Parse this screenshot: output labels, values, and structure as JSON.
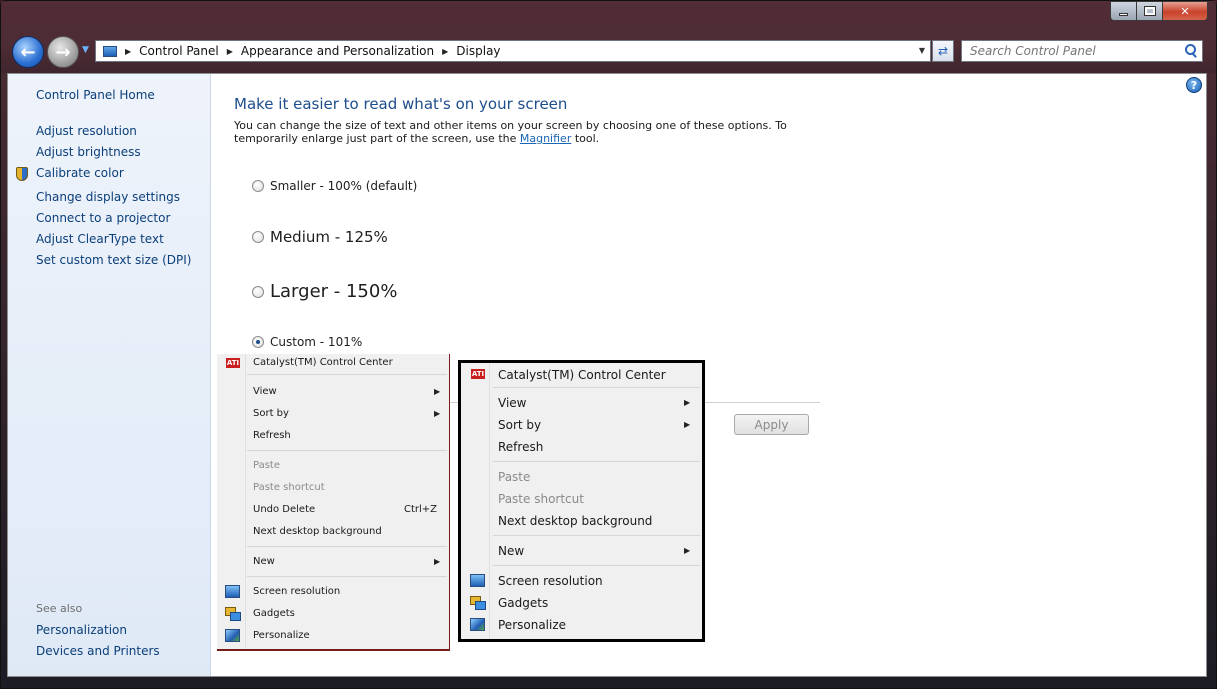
{
  "window": {
    "controls": {
      "minimize": "",
      "maximize": "",
      "close": "✕"
    }
  },
  "nav": {
    "back_icon": "back-arrow-icon",
    "forward_icon": "forward-arrow-icon",
    "breadcrumbs": [
      "Control Panel",
      "Appearance and Personalization",
      "Display"
    ],
    "search_placeholder": "Search Control Panel"
  },
  "sidebar": {
    "home": "Control Panel Home",
    "items": [
      {
        "label": "Adjust resolution"
      },
      {
        "label": "Adjust brightness"
      },
      {
        "label": "Calibrate color",
        "icon": "uac-shield-icon"
      },
      {
        "label": "Change display settings"
      },
      {
        "label": "Connect to a projector"
      },
      {
        "label": "Adjust ClearType text"
      },
      {
        "label": "Set custom text size (DPI)"
      }
    ],
    "see_also": "See also",
    "see_also_items": [
      "Personalization",
      "Devices and Printers"
    ]
  },
  "main": {
    "title": "Make it easier to read what's on your screen",
    "description_pre": "You can change the size of text and other items on your screen by choosing one of these options. To temporarily enlarge just part of the screen, use the ",
    "description_link": "Magnifier",
    "description_post": " tool.",
    "options": [
      {
        "label": "Smaller - 100% (default)",
        "checked": false
      },
      {
        "label": "Medium - 125%",
        "checked": false
      },
      {
        "label": "Larger - 150%",
        "checked": false
      },
      {
        "label": "Custom - 101%",
        "checked": true
      }
    ],
    "apply": "Apply"
  },
  "menu_small": {
    "catalyst": "Catalyst(TM) Control Center",
    "view": "View",
    "sort_by": "Sort by",
    "refresh": "Refresh",
    "paste": "Paste",
    "paste_shortcut": "Paste shortcut",
    "undo_delete": "Undo Delete",
    "undo_shortcut": "Ctrl+Z",
    "next_bg": "Next desktop background",
    "new": "New",
    "screen_resolution": "Screen resolution",
    "gadgets": "Gadgets",
    "personalize": "Personalize"
  },
  "menu_large": {
    "catalyst": "Catalyst(TM) Control Center",
    "view": "View",
    "sort_by": "Sort by",
    "refresh": "Refresh",
    "paste": "Paste",
    "paste_shortcut": "Paste shortcut",
    "next_bg": "Next desktop background",
    "new": "New",
    "screen_resolution": "Screen resolution",
    "gadgets": "Gadgets",
    "personalize": "Personalize"
  },
  "icons": {
    "ati_label": "ATI"
  },
  "colors": {
    "link": "#0b3f7a",
    "title": "#1d4d8c",
    "close_button": "#c8432c"
  }
}
